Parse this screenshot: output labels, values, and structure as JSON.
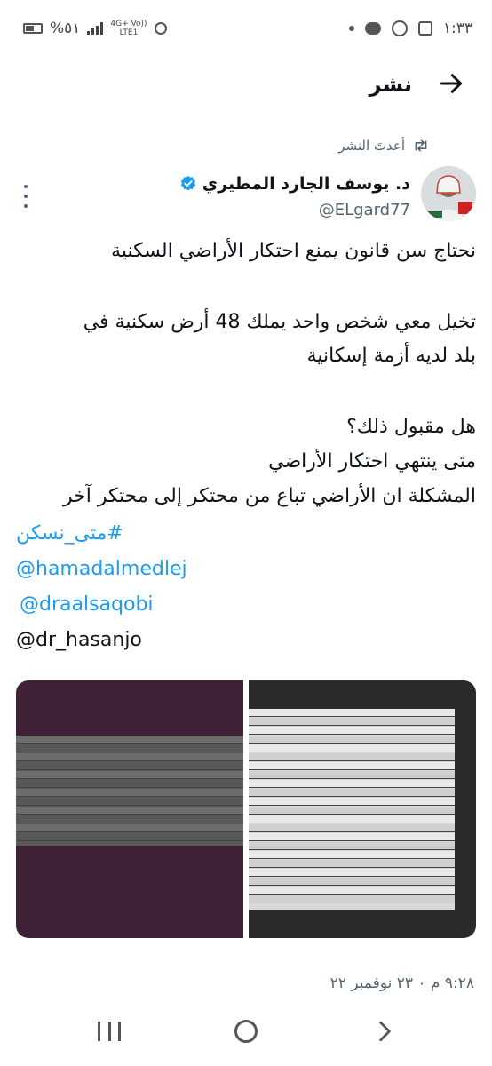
{
  "status_bar": {
    "time": "١:٣٣",
    "battery": "%٥١",
    "network_top": "4G+ Vo))",
    "network_bottom": "LTE1"
  },
  "header": {
    "title": "نشر"
  },
  "repost": {
    "label": "أعدتَ النشر"
  },
  "author": {
    "name": "د. يوسف الجارد المطيري",
    "handle": "@ELgard77"
  },
  "tweet": {
    "line1": "نحتاج سن قانون يمنع احتكار الأراضي  السكنية",
    "line2": "تخيل معي شخص واحد يملك 48 أرض سكنية في",
    "line3": "بلد لديه أزمة إسكانية",
    "line4": "هل مقبول ذلك؟",
    "line5": "متى ينتهي احتكار الأراضي",
    "line6": "المشكلة ان الأراضي تباع من محتكر إلى محتكر آخر",
    "hashtag": "#متى_نسكن",
    "mention1": "@hamadalmedlej",
    "mention2": "@draalsaqobi",
    "mention3": "@dr_hasanjo"
  },
  "timestamp": "٩:٢٨ م ٠ ٢٣ نوفمبر ٢٢",
  "colors": {
    "link": "#1d9bf0",
    "verified": "#1d9bf0",
    "secondary_text": "#536471",
    "image_left_bg": "#3f2238",
    "image_right_bg": "#2a2a2a"
  }
}
